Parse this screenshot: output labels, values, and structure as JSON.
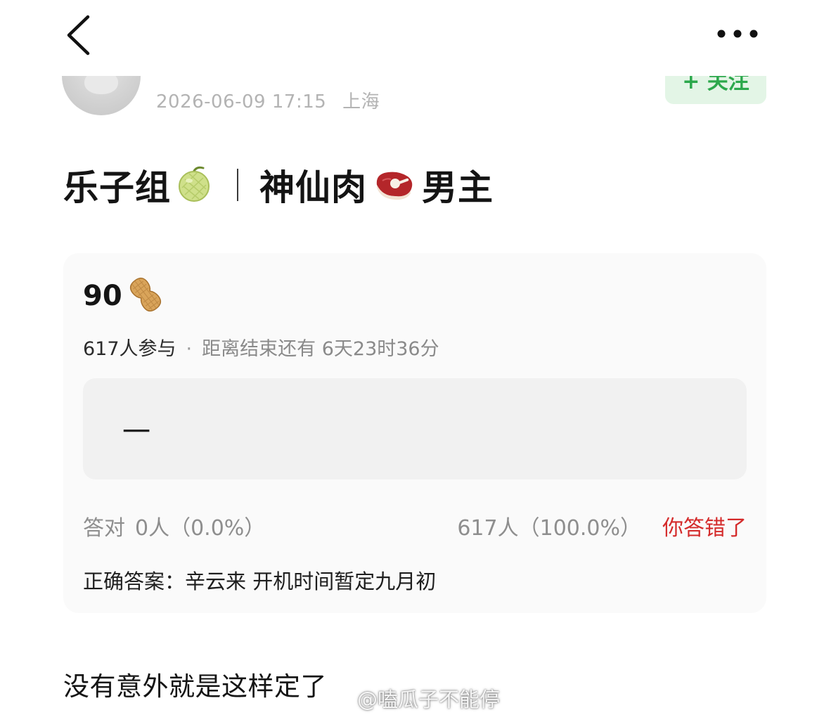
{
  "nav": {
    "back_icon": "chevron-left-icon",
    "more_icon": "more-dots-icon"
  },
  "author": {
    "timestamp": "2026-06-09 17:15",
    "location": "上海",
    "follow_label": "+ 关注"
  },
  "post": {
    "title_part1": "乐子组",
    "title_emoji1": "melon-icon",
    "title_part2": "神仙肉",
    "title_emoji2": "meat-icon",
    "title_part3": "男主",
    "body_text": "没有意外就是这样定了"
  },
  "quiz": {
    "score": "90",
    "score_icon": "peanut-icon",
    "participants": "617人参与",
    "separator": "·",
    "countdown": "距离结束还有 6天23时36分",
    "my_answer": "一",
    "correct_label": "答对",
    "correct_count": "0人（0.0%）",
    "wrong_count": "617人（100.0%）",
    "wrong_badge": "你答错了",
    "correct_answer": "正确答案：辛云来 开机时间暂定九月初"
  },
  "watermark": {
    "text": "@嗑瓜子不能停",
    "icon": "weibo-logo-icon"
  },
  "colors": {
    "accent_green": "#2ca84c",
    "follow_bg": "#e3f5e6",
    "wrong_red": "#d42a2a",
    "card_bg": "#fafafa",
    "meta_gray": "#b3b3b3"
  }
}
